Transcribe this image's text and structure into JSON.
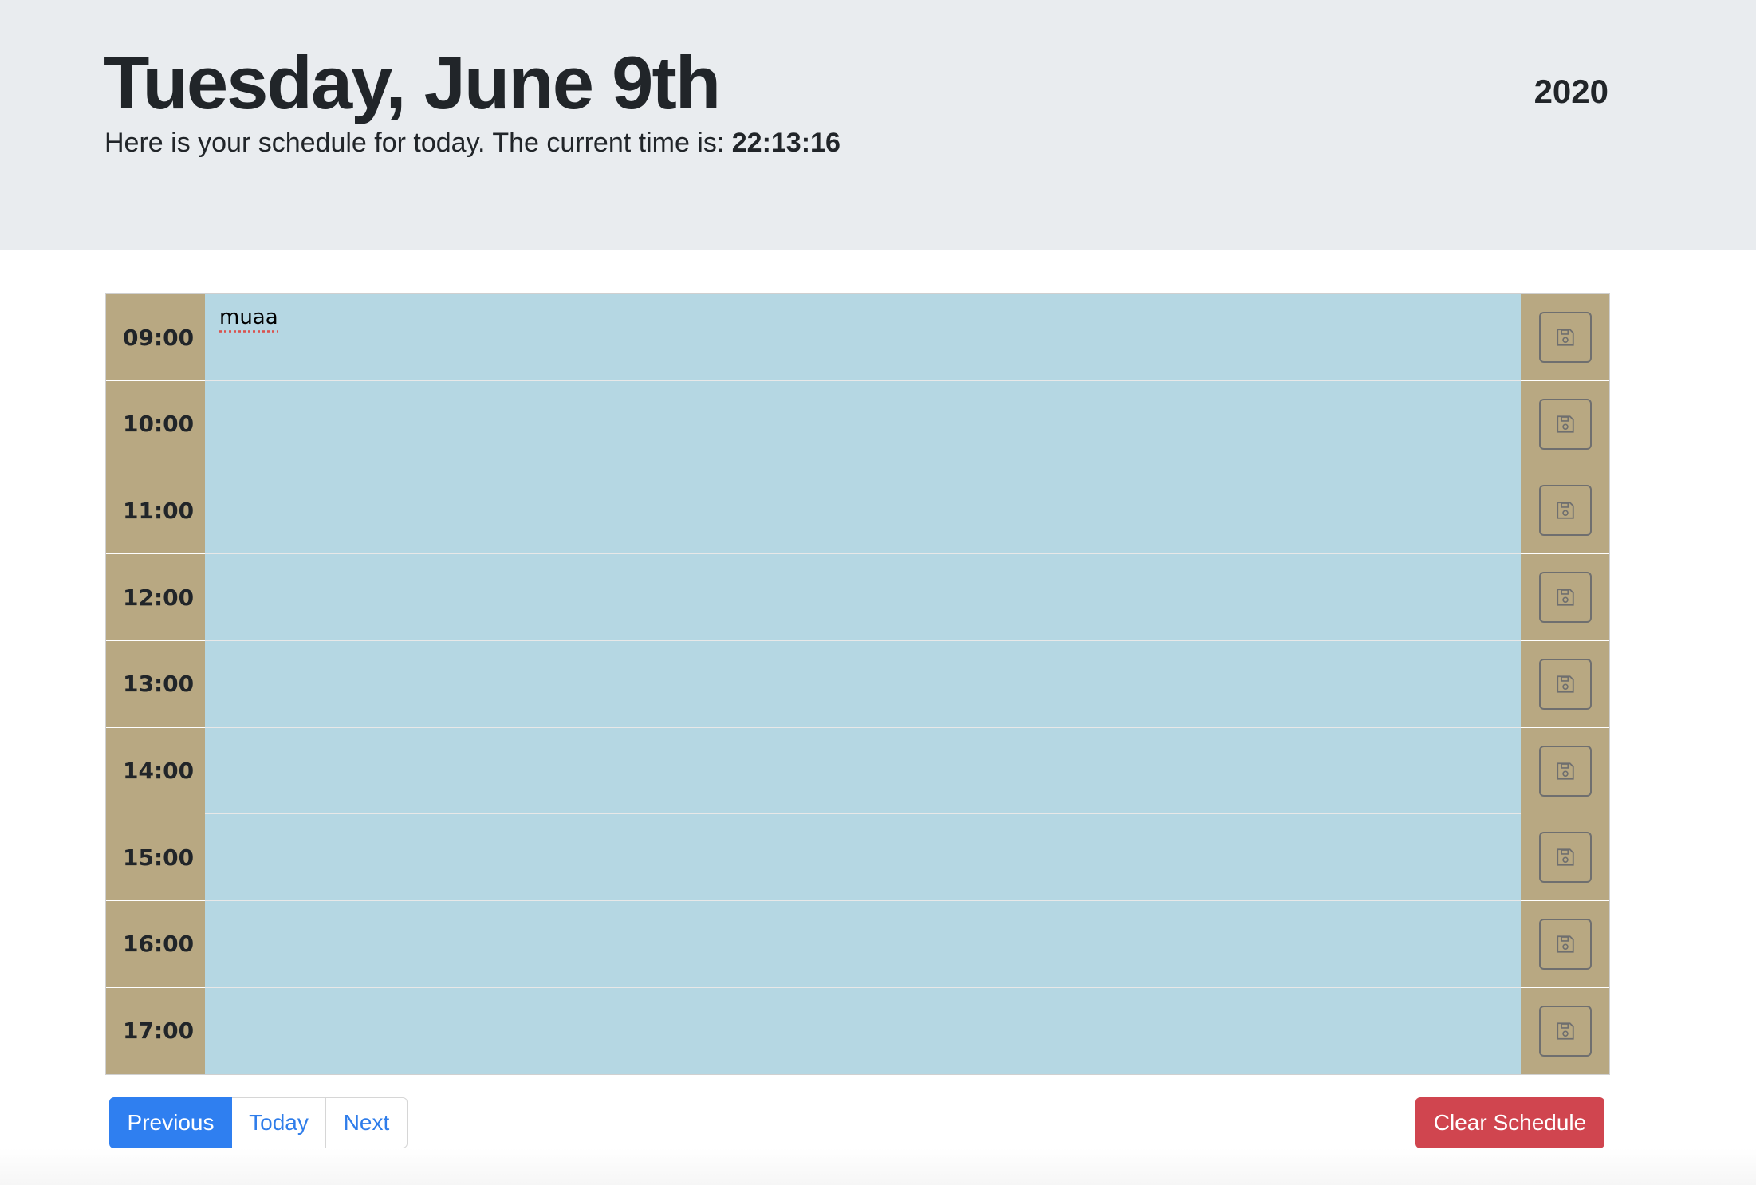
{
  "header": {
    "title": "Tuesday, June 9th",
    "year": "2020",
    "lead_prefix": "Here is your schedule for today. The current time is: ",
    "current_time": "22:13:16"
  },
  "schedule": {
    "rows": [
      {
        "hour": "09:00",
        "note": "muaa"
      },
      {
        "hour": "10:00",
        "note": ""
      },
      {
        "hour": "11:00",
        "note": ""
      },
      {
        "hour": "12:00",
        "note": ""
      },
      {
        "hour": "13:00",
        "note": ""
      },
      {
        "hour": "14:00",
        "note": ""
      },
      {
        "hour": "15:00",
        "note": ""
      },
      {
        "hour": "16:00",
        "note": ""
      },
      {
        "hour": "17:00",
        "note": ""
      }
    ],
    "save_icon": "floppy-disk-icon"
  },
  "nav": {
    "previous": "Previous",
    "today": "Today",
    "next": "Next"
  },
  "actions": {
    "clear": "Clear Schedule"
  },
  "colors": {
    "hour_bg": "#b8a882",
    "note_bg": "#b5d7e3",
    "primary": "#2f7ff0",
    "danger": "#d0454f"
  }
}
